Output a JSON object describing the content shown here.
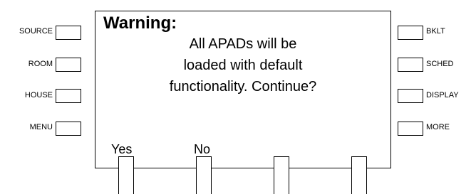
{
  "left_buttons": [
    {
      "label": "SOURCE"
    },
    {
      "label": "ROOM"
    },
    {
      "label": "HOUSE"
    },
    {
      "label": "MENU"
    }
  ],
  "right_buttons": [
    {
      "label": "BKLT"
    },
    {
      "label": "SCHED"
    },
    {
      "label": "DISPLAY"
    },
    {
      "label": "MORE"
    }
  ],
  "screen": {
    "title": "Warning:",
    "message_lines": [
      "All APADs will be",
      "loaded with default",
      "functionality. Continue?"
    ],
    "softkeys": [
      {
        "label": "Yes"
      },
      {
        "label": "No"
      },
      {
        "label": ""
      },
      {
        "label": ""
      }
    ]
  }
}
